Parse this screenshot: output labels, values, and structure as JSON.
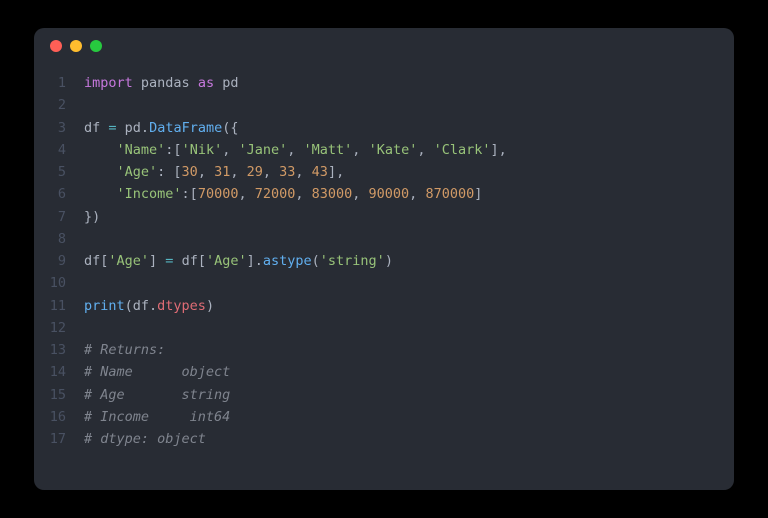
{
  "window": {
    "traffic_lights": [
      "red",
      "yellow",
      "green"
    ]
  },
  "code": {
    "lines": [
      {
        "n": "1",
        "tokens": [
          [
            "kw-import",
            "import"
          ],
          [
            "ident",
            " pandas "
          ],
          [
            "kw-as",
            "as"
          ],
          [
            "ident",
            " pd"
          ]
        ]
      },
      {
        "n": "2",
        "tokens": []
      },
      {
        "n": "3",
        "tokens": [
          [
            "ident",
            "df "
          ],
          [
            "op",
            "="
          ],
          [
            "ident",
            " pd"
          ],
          [
            "punct",
            "."
          ],
          [
            "func",
            "DataFrame"
          ],
          [
            "punct",
            "({"
          ]
        ]
      },
      {
        "n": "4",
        "tokens": [
          [
            "ident",
            "    "
          ],
          [
            "str",
            "'Name'"
          ],
          [
            "punct",
            ":["
          ],
          [
            "str",
            "'Nik'"
          ],
          [
            "punct",
            ", "
          ],
          [
            "str",
            "'Jane'"
          ],
          [
            "punct",
            ", "
          ],
          [
            "str",
            "'Matt'"
          ],
          [
            "punct",
            ", "
          ],
          [
            "str",
            "'Kate'"
          ],
          [
            "punct",
            ", "
          ],
          [
            "str",
            "'Clark'"
          ],
          [
            "punct",
            "],"
          ]
        ]
      },
      {
        "n": "5",
        "tokens": [
          [
            "ident",
            "    "
          ],
          [
            "str",
            "'Age'"
          ],
          [
            "punct",
            ": ["
          ],
          [
            "num",
            "30"
          ],
          [
            "punct",
            ", "
          ],
          [
            "num",
            "31"
          ],
          [
            "punct",
            ", "
          ],
          [
            "num",
            "29"
          ],
          [
            "punct",
            ", "
          ],
          [
            "num",
            "33"
          ],
          [
            "punct",
            ", "
          ],
          [
            "num",
            "43"
          ],
          [
            "punct",
            "],"
          ]
        ]
      },
      {
        "n": "6",
        "tokens": [
          [
            "ident",
            "    "
          ],
          [
            "str",
            "'Income'"
          ],
          [
            "punct",
            ":["
          ],
          [
            "num",
            "70000"
          ],
          [
            "punct",
            ", "
          ],
          [
            "num",
            "72000"
          ],
          [
            "punct",
            ", "
          ],
          [
            "num",
            "83000"
          ],
          [
            "punct",
            ", "
          ],
          [
            "num",
            "90000"
          ],
          [
            "punct",
            ", "
          ],
          [
            "num",
            "870000"
          ],
          [
            "punct",
            "]"
          ]
        ]
      },
      {
        "n": "7",
        "tokens": [
          [
            "punct",
            "})"
          ]
        ]
      },
      {
        "n": "8",
        "tokens": []
      },
      {
        "n": "9",
        "tokens": [
          [
            "ident",
            "df["
          ],
          [
            "str",
            "'Age'"
          ],
          [
            "punct",
            "] "
          ],
          [
            "op",
            "="
          ],
          [
            "ident",
            " df["
          ],
          [
            "str",
            "'Age'"
          ],
          [
            "punct",
            "]."
          ],
          [
            "method",
            "astype"
          ],
          [
            "punct",
            "("
          ],
          [
            "str",
            "'string'"
          ],
          [
            "punct",
            ")"
          ]
        ]
      },
      {
        "n": "10",
        "tokens": []
      },
      {
        "n": "11",
        "tokens": [
          [
            "func",
            "print"
          ],
          [
            "punct",
            "(df."
          ],
          [
            "attr",
            "dtypes"
          ],
          [
            "punct",
            ")"
          ]
        ]
      },
      {
        "n": "12",
        "tokens": []
      },
      {
        "n": "13",
        "tokens": [
          [
            "comment",
            "# Returns:"
          ]
        ]
      },
      {
        "n": "14",
        "tokens": [
          [
            "comment",
            "# Name      object"
          ]
        ]
      },
      {
        "n": "15",
        "tokens": [
          [
            "comment",
            "# Age       string"
          ]
        ]
      },
      {
        "n": "16",
        "tokens": [
          [
            "comment",
            "# Income     int64"
          ]
        ]
      },
      {
        "n": "17",
        "tokens": [
          [
            "comment",
            "# dtype: object"
          ]
        ]
      }
    ]
  }
}
